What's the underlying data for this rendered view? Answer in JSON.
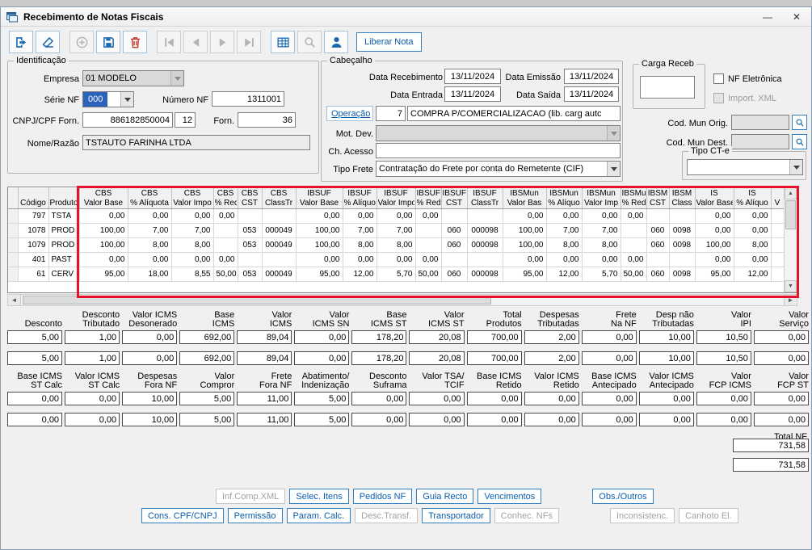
{
  "colors": {
    "accent_blue": "#0b5cad",
    "button_border": "#2f7fc1",
    "highlight_red": "#e8112d",
    "selection_blue": "#2a62bc",
    "delete_red": "#c0392b"
  },
  "window": {
    "title": "Recebimento de Notas Fiscais",
    "minimize_glyph": "—",
    "close_glyph": "✕"
  },
  "toolbar": {
    "buttons": [
      {
        "name": "exit",
        "icon": "exit-icon",
        "enabled": true
      },
      {
        "name": "clear",
        "icon": "eraser-icon",
        "enabled": true
      },
      {
        "name": "add",
        "icon": "plus-circle-icon",
        "enabled": false,
        "gap_before": true
      },
      {
        "name": "save",
        "icon": "save-icon",
        "enabled": true
      },
      {
        "name": "delete",
        "icon": "trash-icon",
        "enabled": true,
        "color": "#c0392b"
      },
      {
        "name": "nav-first",
        "icon": "nav-first-icon",
        "enabled": false,
        "gap_before": true
      },
      {
        "name": "nav-prev",
        "icon": "nav-prev-icon",
        "enabled": false
      },
      {
        "name": "nav-next",
        "icon": "nav-next-icon",
        "enabled": false
      },
      {
        "name": "nav-last",
        "icon": "nav-last-icon",
        "enabled": false
      },
      {
        "name": "grid-view",
        "icon": "grid-icon",
        "enabled": true,
        "gap_before": true
      },
      {
        "name": "search",
        "icon": "search-icon",
        "enabled": false
      },
      {
        "name": "user",
        "icon": "user-icon",
        "enabled": true
      }
    ],
    "liberar_nota_label": "Liberar Nota"
  },
  "identificacao": {
    "title": "Identificação",
    "empresa": {
      "label": "Empresa",
      "value": "01 MODELO"
    },
    "serie_nf": {
      "label": "Série NF",
      "value": "000"
    },
    "numero_nf": {
      "label": "Número NF",
      "value": "1311001"
    },
    "cnpj_cpf": {
      "label": "CNPJ/CPF Forn.",
      "value": "886182850004",
      "digito": "12"
    },
    "fornecedor": {
      "label": "Forn.",
      "value": "36"
    },
    "nome_razao": {
      "label": "Nome/Razão",
      "value": "TSTAUTO FARINHA LTDA"
    }
  },
  "cabecalho": {
    "title": "Cabeçalho",
    "data_recebimento": {
      "label": "Data Recebimento",
      "value": "13/11/2024"
    },
    "data_emissao": {
      "label": "Data Emissão",
      "value": "13/11/2024"
    },
    "data_entrada": {
      "label": "Data Entrada",
      "value": "13/11/2024"
    },
    "data_saida": {
      "label": "Data Saída",
      "value": "13/11/2024"
    },
    "operacao": {
      "button_label": "Operação",
      "codigo": "7",
      "descricao": "COMPRA P/COMERCIALIZACAO (lib. carg autc"
    },
    "mot_dev": {
      "label": "Mot. Dev.",
      "value": ""
    },
    "ch_acesso": {
      "label": "Ch. Acesso",
      "value": ""
    },
    "tipo_frete": {
      "label": "Tipo Frete",
      "value": "Contratação do Frete por conta do Remetente (CIF)"
    }
  },
  "carga_receb": {
    "title": "Carga Receb",
    "value": ""
  },
  "opcoes": {
    "nf_eletronica": {
      "label": "NF Eletrônica",
      "checked": false
    },
    "import_xml": {
      "label": "Import. XML",
      "checked": false,
      "enabled": false
    },
    "cod_mun_orig": {
      "label": "Cod. Mun Orig.",
      "value": ""
    },
    "cod_mun_dest": {
      "label": "Cod. Mun Dest.",
      "value": ""
    },
    "tipo_cte": {
      "label": "Tipo CT-e",
      "value": ""
    }
  },
  "grid": {
    "columns": [
      {
        "l1": "",
        "l2": "Código"
      },
      {
        "l1": "",
        "l2": "Produto"
      },
      {
        "l1": "CBS",
        "l2": "Valor Base"
      },
      {
        "l1": "CBS",
        "l2": "% Alíquota"
      },
      {
        "l1": "CBS",
        "l2": "Valor Impo"
      },
      {
        "l1": "CBS",
        "l2": "% Red"
      },
      {
        "l1": "CBS",
        "l2": "CST"
      },
      {
        "l1": "CBS",
        "l2": "ClassTr"
      },
      {
        "l1": "IBSUF",
        "l2": "Valor Base"
      },
      {
        "l1": "IBSUF",
        "l2": "% Alíquo"
      },
      {
        "l1": "IBSUF",
        "l2": "Valor Impo"
      },
      {
        "l1": "IBSUF",
        "l2": "% Red"
      },
      {
        "l1": "IBSUF",
        "l2": "CST"
      },
      {
        "l1": "IBSUF",
        "l2": "ClassTr"
      },
      {
        "l1": "IBSMun",
        "l2": "Valor Bas"
      },
      {
        "l1": "IBSMun",
        "l2": "% Alíquo"
      },
      {
        "l1": "IBSMun",
        "l2": "Valor Imp"
      },
      {
        "l1": "IBSMu",
        "l2": "% Red"
      },
      {
        "l1": "IBSM",
        "l2": "CST"
      },
      {
        "l1": "IBSM",
        "l2": "Class"
      },
      {
        "l1": "IS",
        "l2": "Valor Base"
      },
      {
        "l1": "IS",
        "l2": "% Alíquo"
      },
      {
        "l1": "",
        "l2": "V"
      }
    ],
    "rows": [
      [
        "797",
        "TSTA",
        "0,00",
        "0,00",
        "0,00",
        "0,00",
        "",
        "",
        "0,00",
        "0,00",
        "0,00",
        "0,00",
        "",
        "",
        "0,00",
        "0,00",
        "0,00",
        "0,00",
        "",
        "",
        "0,00",
        "0,00",
        ""
      ],
      [
        "1078",
        "PROD",
        "100,00",
        "7,00",
        "7,00",
        "",
        "053",
        "000049",
        "100,00",
        "7,00",
        "7,00",
        "",
        "060",
        "000098",
        "100,00",
        "7,00",
        "7,00",
        "",
        "060",
        "0098",
        "0,00",
        "0,00",
        ""
      ],
      [
        "1079",
        "PROD",
        "100,00",
        "8,00",
        "8,00",
        "",
        "053",
        "000049",
        "100,00",
        "8,00",
        "8,00",
        "",
        "060",
        "000098",
        "100,00",
        "8,00",
        "8,00",
        "",
        "060",
        "0098",
        "100,00",
        "8,00",
        ""
      ],
      [
        "401",
        "PAST",
        "0,00",
        "0,00",
        "0,00",
        "0,00",
        "",
        "",
        "0,00",
        "0,00",
        "0,00",
        "0,00",
        "",
        "",
        "0,00",
        "0,00",
        "0,00",
        "0,00",
        "",
        "",
        "0,00",
        "0,00",
        ""
      ],
      [
        "61",
        "CERV",
        "95,00",
        "18,00",
        "8,55",
        "50,00",
        "053",
        "000049",
        "95,00",
        "12,00",
        "5,70",
        "50,00",
        "060",
        "000098",
        "95,00",
        "12,00",
        "5,70",
        "50,00",
        "060",
        "0098",
        "95,00",
        "12,00",
        ""
      ]
    ]
  },
  "totais": {
    "section_a": {
      "headers": [
        "Desconto",
        "Desconto\nTributado",
        "Valor ICMS\nDesonerado",
        "Base\nICMS",
        "Valor\nICMS",
        "Valor\nICMS SN",
        "Base\nICMS ST",
        "Valor\nICMS ST",
        "Total\nProdutos",
        "Despesas\nTributadas",
        "Frete\nNa NF",
        "Desp não\nTributadas",
        "Valor\nIPI",
        "Valor\nServiço"
      ],
      "valores_nf": [
        "5,00",
        "1,00",
        "0,00",
        "692,00",
        "89,04",
        "0,00",
        "178,20",
        "20,08",
        "700,00",
        "2,00",
        "0,00",
        "10,00",
        "10,50",
        "0,00"
      ],
      "valores_calc": [
        "5,00",
        "1,00",
        "0,00",
        "692,00",
        "89,04",
        "0,00",
        "178,20",
        "20,08",
        "700,00",
        "2,00",
        "0,00",
        "10,00",
        "10,50",
        "0,00"
      ]
    },
    "section_b": {
      "headers": [
        "Base ICMS\nST Calc",
        "Valor ICMS\nST Calc",
        "Despesas\nFora NF",
        "Valor\nCompror",
        "Frete\nFora NF",
        "Abatimento/\nIndenização",
        "Desconto\nSuframa",
        "Valor TSA/\nTCIF",
        "Base ICMS\nRetido",
        "Valor ICMS\nRetido",
        "Base ICMS\nAntecipado",
        "Valor ICMS\nAntecipado",
        "Valor\nFCP ICMS",
        "Valor\nFCP ST"
      ],
      "valores_nf": [
        "0,00",
        "0,00",
        "10,00",
        "5,00",
        "11,00",
        "5,00",
        "0,00",
        "0,00",
        "0,00",
        "0,00",
        "0,00",
        "0,00",
        "0,00",
        "0,00"
      ],
      "valores_calc": [
        "0,00",
        "0,00",
        "10,00",
        "5,00",
        "11,00",
        "5,00",
        "0,00",
        "0,00",
        "0,00",
        "0,00",
        "0,00",
        "0,00",
        "0,00",
        "0,00"
      ]
    },
    "total_nf": {
      "label": "Total NF",
      "values": [
        "731,58",
        "731,58"
      ]
    }
  },
  "action_buttons": {
    "row1": [
      {
        "label": "Inf.Comp.XML",
        "enabled": false
      },
      {
        "label": "Selec. Itens",
        "enabled": true
      },
      {
        "label": "Pedidos NF",
        "enabled": true
      },
      {
        "label": "Guia Recto",
        "enabled": true
      },
      {
        "label": "Vencimentos",
        "enabled": true
      },
      {
        "label": "Obs./Outros",
        "enabled": true,
        "gap_before": true
      }
    ],
    "row2": [
      {
        "label": "Cons. CPF/CNPJ",
        "enabled": true
      },
      {
        "label": "Permissão",
        "enabled": true
      },
      {
        "label": "Param. Calc.",
        "enabled": true
      },
      {
        "label": "Desc.Transf.",
        "enabled": false
      },
      {
        "label": "Transportador",
        "enabled": true
      },
      {
        "label": "Conhec. NFs",
        "enabled": false
      },
      {
        "label": "Inconsistenc.",
        "enabled": false,
        "gap_before": true
      },
      {
        "label": "Canhoto El.",
        "enabled": false
      }
    ]
  }
}
